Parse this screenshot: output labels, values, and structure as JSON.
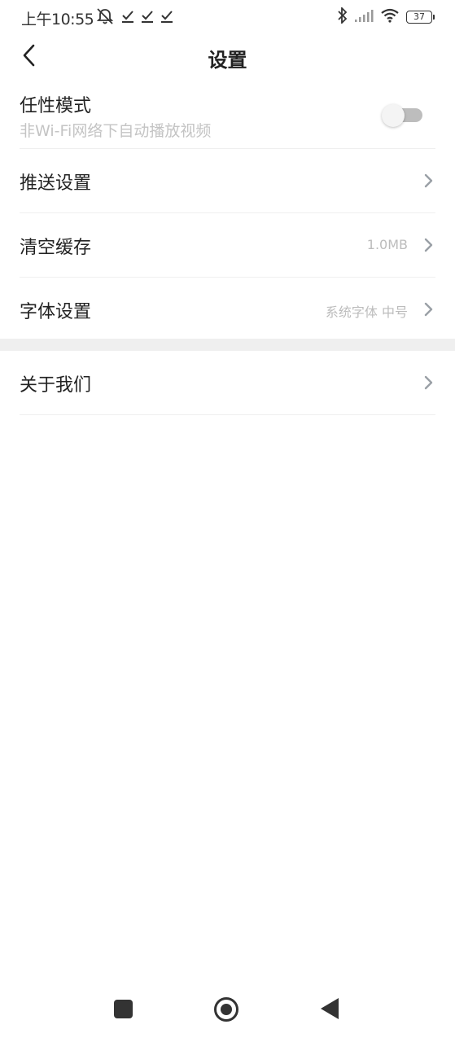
{
  "status_bar": {
    "time": "上午10:55",
    "battery": "37",
    "icons": [
      "mute-icon",
      "check-icon",
      "check-icon",
      "check-icon",
      "bluetooth-icon",
      "signal-icon",
      "wifi-icon",
      "battery-icon"
    ]
  },
  "header": {
    "title": "设置",
    "back_icon": "chevron-left-icon"
  },
  "settings": {
    "toggle_item": {
      "label": "任性模式",
      "sublabel": "非Wi-Fi网络下自动播放视频",
      "enabled": false
    },
    "items": [
      {
        "label": "推送设置",
        "value": ""
      },
      {
        "label": "清空缓存",
        "value": "1.0MB"
      },
      {
        "label": "字体设置",
        "value": "系统字体 中号"
      }
    ],
    "section2_items": [
      {
        "label": "关于我们",
        "value": ""
      }
    ]
  },
  "colors": {
    "text_primary": "#222222",
    "text_secondary": "#bcbcbc",
    "divider": "#efefef",
    "chevron": "#9aa0a6"
  },
  "nav_bar": {
    "icons": [
      "recents-icon",
      "home-icon",
      "back-triangle-icon"
    ]
  }
}
